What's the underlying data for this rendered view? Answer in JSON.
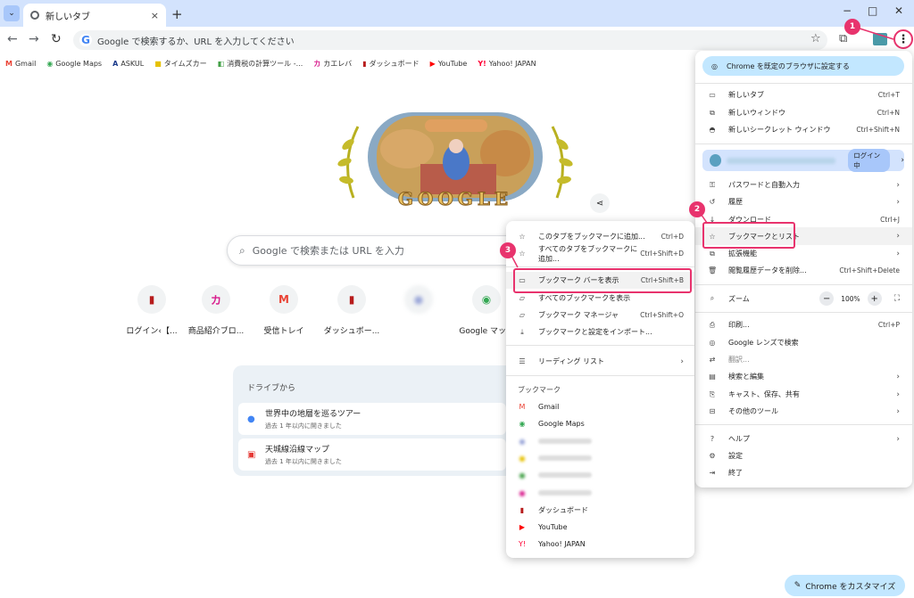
{
  "tab": {
    "title": "新しいタブ",
    "close": "×",
    "new": "+"
  },
  "window": {
    "minimize": "−",
    "maximize": "□",
    "close": "✕"
  },
  "omnibox": {
    "text": "Google で検索するか、URL を入力してください"
  },
  "bookmarks_bar": [
    {
      "icon": "M",
      "label": "Gmail",
      "color": "#ea4335"
    },
    {
      "icon": "◉",
      "label": "Google Maps",
      "color": "#34a853"
    },
    {
      "icon": "A",
      "label": "ASKUL",
      "color": "#1a3a8a"
    },
    {
      "icon": "■",
      "label": "タイムズカー",
      "color": "#e6c100"
    },
    {
      "icon": "◧",
      "label": "消費税の計算ツール -...",
      "color": "#43a047"
    },
    {
      "icon": "カ",
      "label": "カエレバ",
      "color": "#d81b8c"
    },
    {
      "icon": "▮",
      "label": "ダッシュボード",
      "color": "#b71c1c"
    },
    {
      "icon": "▶",
      "label": "YouTube",
      "color": "#ff0000"
    },
    {
      "icon": "Y!",
      "label": "Yahoo! JAPAN",
      "color": "#ff0033"
    }
  ],
  "doodle": {
    "text": "GOOGLE"
  },
  "search": {
    "placeholder": "Google で検索または URL を入力"
  },
  "shortcuts": [
    {
      "icon": "▮",
      "label": "ログイン‹【...",
      "color": "#b71c1c"
    },
    {
      "icon": "カ",
      "label": "商品紹介ブロ...",
      "color": "#d81b8c"
    },
    {
      "icon": "M",
      "label": "受信トレイ",
      "color": "#ea4335"
    },
    {
      "icon": "▮",
      "label": "ダッシュボー...",
      "color": "#b71c1c"
    },
    {
      "icon": "●",
      "label": "",
      "color": "#9aa6d8"
    },
    {
      "icon": "◉",
      "label": "Google マッ...",
      "color": "#34a853"
    }
  ],
  "drive": {
    "heading": "ドライブから",
    "items": [
      {
        "title": "世界中の地層を巡るツアー",
        "sub": "過去 1 年以内に開きました"
      },
      {
        "title": "天城線沿線マップ",
        "sub": "過去 1 年以内に開きました"
      }
    ]
  },
  "customize": {
    "label": "Chrome をカスタマイズ"
  },
  "menu": {
    "default_browser": "Chrome を既定のブラウザに設定する",
    "new_tab": {
      "label": "新しいタブ",
      "shortcut": "Ctrl+T"
    },
    "new_window": {
      "label": "新しいウィンドウ",
      "shortcut": "Ctrl+N"
    },
    "incognito": {
      "label": "新しいシークレット ウィンドウ",
      "shortcut": "Ctrl+Shift+N"
    },
    "profile": {
      "status": "ログイン中"
    },
    "passwords": {
      "label": "パスワードと自動入力"
    },
    "history": {
      "label": "履歴"
    },
    "downloads": {
      "label": "ダウンロード",
      "shortcut": "Ctrl+J"
    },
    "bookmarks": {
      "label": "ブックマークとリスト"
    },
    "extensions": {
      "label": "拡張機能"
    },
    "clear_data": {
      "label": "閲覧履歴データを削除...",
      "shortcut": "Ctrl+Shift+Delete"
    },
    "zoom": {
      "label": "ズーム",
      "value": "100%",
      "minus": "−",
      "plus": "+"
    },
    "print": {
      "label": "印刷...",
      "shortcut": "Ctrl+P"
    },
    "lens": {
      "label": "Google レンズで検索"
    },
    "translate": {
      "label": "翻訳..."
    },
    "find": {
      "label": "検索と編集"
    },
    "cast": {
      "label": "キャスト、保存、共有"
    },
    "more_tools": {
      "label": "その他のツール"
    },
    "help": {
      "label": "ヘルプ"
    },
    "settings": {
      "label": "設定"
    },
    "exit": {
      "label": "終了"
    }
  },
  "submenu": {
    "add_tab": {
      "label": "このタブをブックマークに追加...",
      "shortcut": "Ctrl+D"
    },
    "add_all": {
      "label": "すべてのタブをブックマークに追加...",
      "shortcut": "Ctrl+Shift+D"
    },
    "show_bar": {
      "label": "ブックマーク バーを表示",
      "shortcut": "Ctrl+Shift+B"
    },
    "all": {
      "label": "すべてのブックマークを表示"
    },
    "manager": {
      "label": "ブックマーク マネージャ",
      "shortcut": "Ctrl+Shift+O"
    },
    "import": {
      "label": "ブックマークと設定をインポート..."
    },
    "reading": {
      "label": "リーディング リスト"
    },
    "heading": "ブックマーク",
    "items": [
      {
        "icon": "M",
        "label": "Gmail",
        "color": "#ea4335"
      },
      {
        "icon": "◉",
        "label": "Google Maps",
        "color": "#34a853"
      },
      {
        "icon": "●",
        "label": "",
        "color": "#9aa6d8"
      },
      {
        "icon": "●",
        "label": "",
        "color": "#e6c100"
      },
      {
        "icon": "●",
        "label": "",
        "color": "#43a047"
      },
      {
        "icon": "●",
        "label": "",
        "color": "#d81b8c"
      },
      {
        "icon": "▮",
        "label": "ダッシュボード",
        "color": "#b71c1c"
      },
      {
        "icon": "▶",
        "label": "YouTube",
        "color": "#ff0000"
      },
      {
        "icon": "Y!",
        "label": "Yahoo! JAPAN",
        "color": "#ff0033"
      }
    ]
  },
  "badges": [
    "1",
    "2",
    "3"
  ]
}
